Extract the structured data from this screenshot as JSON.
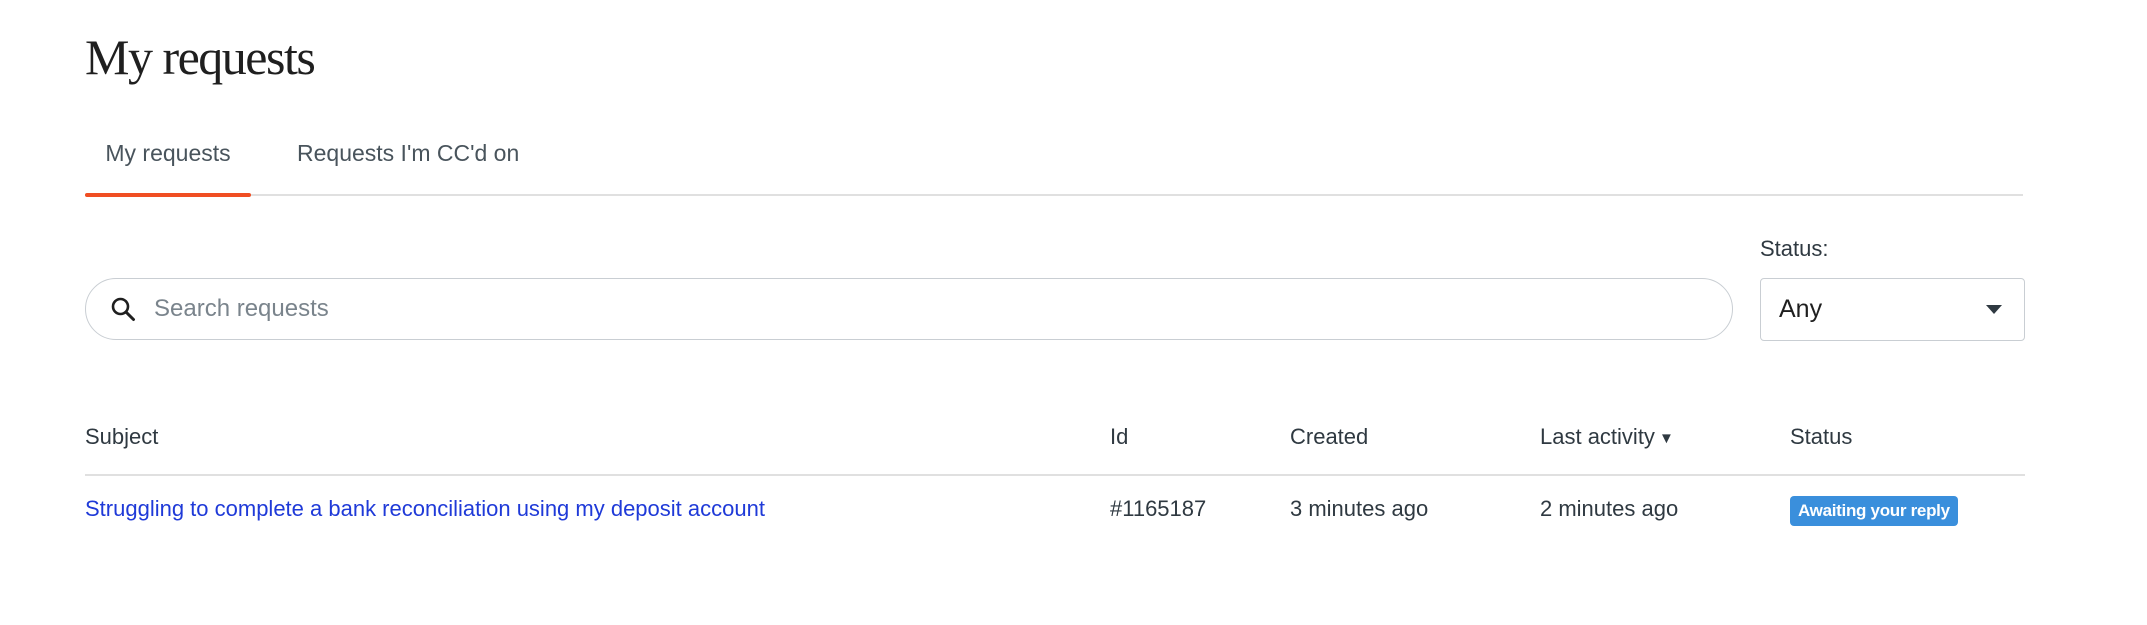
{
  "page": {
    "title": "My requests"
  },
  "tabs": [
    {
      "label": "My requests",
      "active": true
    },
    {
      "label": "Requests I'm CC'd on",
      "active": false
    }
  ],
  "accent_color": "#f04e23",
  "search": {
    "placeholder": "Search requests",
    "value": "",
    "icon": "search-icon"
  },
  "status_filter": {
    "label": "Status:",
    "selected": "Any",
    "icon": "chevron-down-icon"
  },
  "table": {
    "columns": {
      "subject": "Subject",
      "id": "Id",
      "created": "Created",
      "last_activity": "Last activity",
      "last_activity_sort": "▼",
      "status": "Status"
    },
    "rows": [
      {
        "subject": "Struggling to complete a bank reconciliation using my deposit account",
        "id": "#1165187",
        "created": "3 minutes ago",
        "last_activity": "2 minutes ago",
        "status": "Awaiting your reply",
        "status_color": "#3a8fdc"
      }
    ]
  }
}
